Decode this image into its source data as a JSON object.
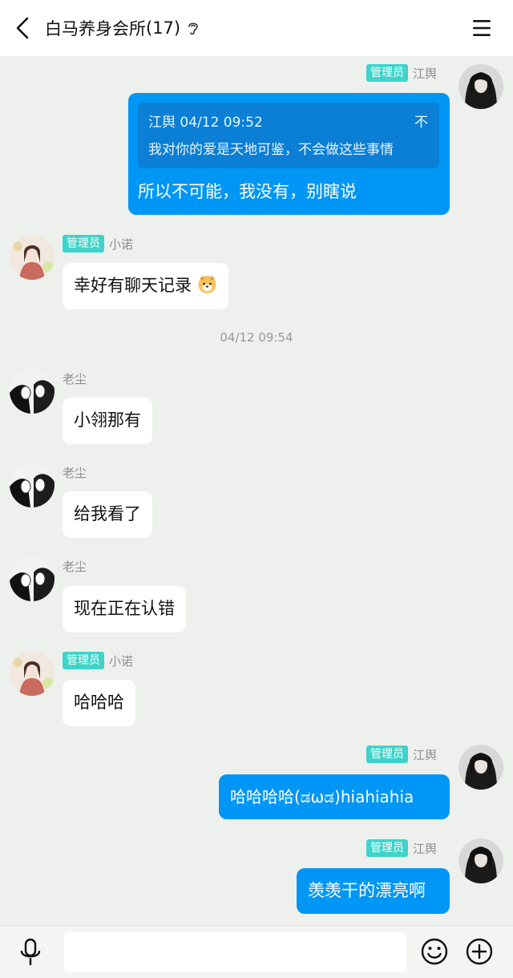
{
  "header": {
    "title": "白马养身会所",
    "member_count": "(17)",
    "back_icon": "chevron-left-icon",
    "ear_icon": "ear-icon",
    "menu_icon": "hamburger-menu-icon"
  },
  "badge_label": "管理员",
  "messages": [
    {
      "sender": "江舆",
      "role": "管理员",
      "side": "right",
      "quote": {
        "author_time": "江舆 04/12 09:52",
        "toggle": "不",
        "text": "我对你的爱是天地可鉴，不会做这些事情"
      },
      "text": "所以不可能，我没有，别瞎说"
    },
    {
      "sender": "小诺",
      "role": "管理员",
      "side": "left",
      "text": "幸好有聊天记录"
    },
    {
      "sender": "老尘",
      "side": "left",
      "text": "小翎那有"
    },
    {
      "sender": "老尘",
      "side": "left",
      "text": "给我看了"
    },
    {
      "sender": "老尘",
      "side": "left",
      "text": "现在正在认错"
    },
    {
      "sender": "小诺",
      "role": "管理员",
      "side": "left",
      "text": "哈哈哈"
    },
    {
      "sender": "江舆",
      "role": "管理员",
      "side": "right",
      "text": "哈哈哈哈(ಡωಡ)hiahiahia"
    },
    {
      "sender": "江舆",
      "role": "管理员",
      "side": "right",
      "text": "羡羡干的漂亮啊"
    }
  ],
  "timestamp": "04/12 09:54",
  "input_bar": {
    "placeholder": "",
    "value": "",
    "mic_icon": "microphone-icon",
    "emoji_icon": "smiley-icon",
    "plus_icon": "plus-circle-icon"
  },
  "colors": {
    "background": "#eef0ed",
    "own_bubble": "#0096f6",
    "quote_box": "#0a7fd5",
    "badge": "#3fd3c9",
    "other_bubble": "#ffffff"
  }
}
